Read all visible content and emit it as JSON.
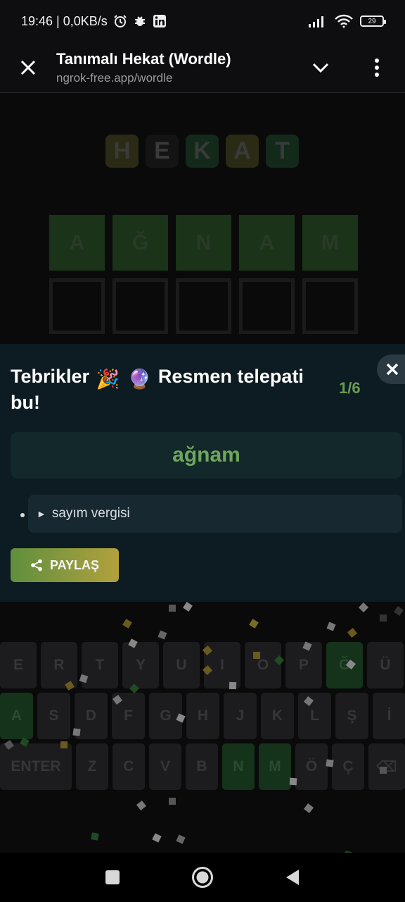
{
  "status_bar": {
    "time_speed": "19:46 | 0,0KB/s",
    "battery": "29"
  },
  "browser": {
    "title": "Tanımalı Hekat (Wordle)",
    "url": "ngrok-free.app/wordle"
  },
  "logo": {
    "letters": [
      "H",
      "E",
      "K",
      "A",
      "T"
    ],
    "colors": [
      "#2b2a14",
      "#141414",
      "#13291a",
      "#2b2a14",
      "#13291a"
    ]
  },
  "board": {
    "rows": [
      [
        "A",
        "Ğ",
        "N",
        "A",
        "M"
      ],
      [
        "",
        "",
        "",
        "",
        ""
      ]
    ]
  },
  "modal": {
    "heading_part1": "Tebrikler",
    "heading_emoji1": "🎉",
    "heading_emoji2": "🔮",
    "heading_part2": "Resmen telepati bu!",
    "attempts": "1/6",
    "answer": "ağnam",
    "meaning": "sayım vergisi",
    "share_label": "PAYLAŞ"
  },
  "keyboard": {
    "row1": [
      "E",
      "R",
      "T",
      "Y",
      "U",
      "I",
      "O",
      "P",
      "Ğ",
      "Ü"
    ],
    "row2": [
      "A",
      "S",
      "D",
      "F",
      "G",
      "H",
      "J",
      "K",
      "L",
      "Ş",
      "İ"
    ],
    "row3": [
      "ENTER",
      "Z",
      "C",
      "V",
      "B",
      "N",
      "M",
      "Ö",
      "Ç",
      "⌫"
    ],
    "green_keys": [
      "Ğ",
      "A",
      "N",
      "M"
    ]
  },
  "colors": {
    "answer_green": "#6ea75c",
    "attempts_green": "#6a9a52",
    "share_gradient_start": "#5f8f3e",
    "share_gradient_end": "#b2a13d",
    "modal_bg": "#0d1b22"
  }
}
